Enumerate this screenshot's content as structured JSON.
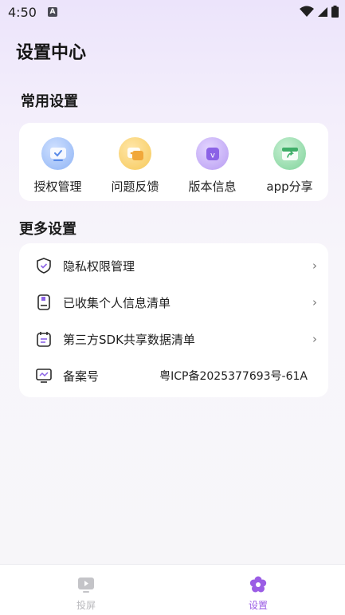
{
  "status": {
    "time": "4:50",
    "notification": "A"
  },
  "header": {
    "title": "设置中心"
  },
  "common": {
    "title": "常用设置",
    "items": [
      {
        "label": "授权管理",
        "icon": "authorization-icon",
        "color": "#8fb4f5"
      },
      {
        "label": "问题反馈",
        "icon": "feedback-icon",
        "color": "#f6c95a"
      },
      {
        "label": "版本信息",
        "icon": "version-icon",
        "color": "#b79bf2"
      },
      {
        "label": "app分享",
        "icon": "share-icon",
        "color": "#7fd39a"
      }
    ]
  },
  "more": {
    "title": "更多设置",
    "items": [
      {
        "label": "隐私权限管理",
        "icon": "shield-icon",
        "chevron": "›"
      },
      {
        "label": "已收集个人信息清单",
        "icon": "notebook-icon",
        "chevron": "›"
      },
      {
        "label": "第三方SDK共享数据清单",
        "icon": "calendar-list-icon",
        "chevron": "›"
      },
      {
        "label": "备案号",
        "icon": "monitor-icon",
        "value": "粤ICP备2025377693号-61A"
      }
    ]
  },
  "tabs": [
    {
      "label": "投屏",
      "icon": "screencast-icon",
      "active": false,
      "color": "#c4c4c8"
    },
    {
      "label": "设置",
      "icon": "settings-flower-icon",
      "active": true,
      "color": "#9b5de5"
    }
  ]
}
